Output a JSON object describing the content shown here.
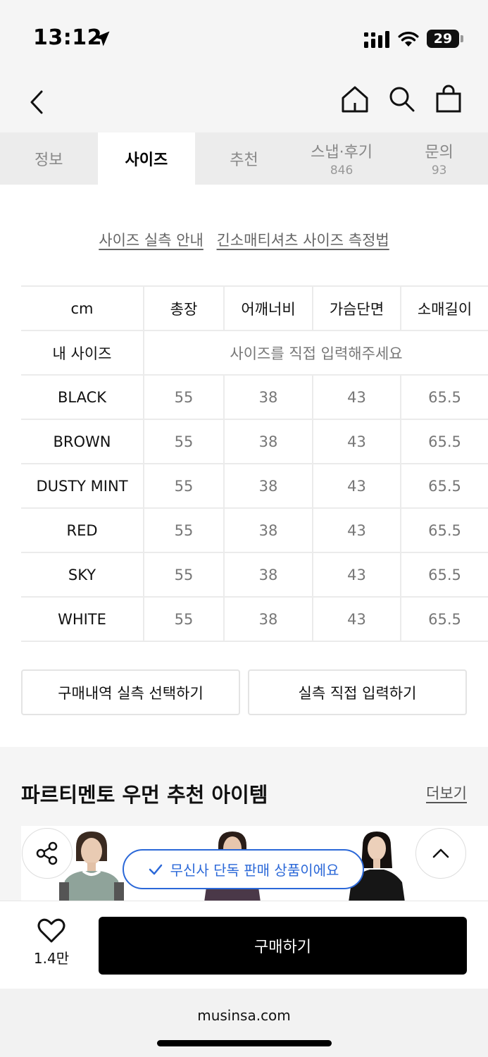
{
  "status": {
    "time": "13:12",
    "battery": "29"
  },
  "tabs": [
    {
      "label": "정보",
      "count": ""
    },
    {
      "label": "사이즈",
      "count": ""
    },
    {
      "label": "추천",
      "count": ""
    },
    {
      "label": "스냅·후기",
      "count": "846"
    },
    {
      "label": "문의",
      "count": "93"
    }
  ],
  "size_links": {
    "guide": "사이즈 실측 안내",
    "method": "긴소매티셔츠 사이즈 측정법"
  },
  "size_table": {
    "headers": [
      "cm",
      "총장",
      "어깨너비",
      "가슴단면",
      "소매길이"
    ],
    "my_size_label": "내 사이즈",
    "my_size_placeholder": "사이즈를 직접 입력해주세요",
    "rows": [
      {
        "name": "BLACK",
        "values": [
          "55",
          "38",
          "43",
          "65.5"
        ]
      },
      {
        "name": "BROWN",
        "values": [
          "55",
          "38",
          "43",
          "65.5"
        ]
      },
      {
        "name": "DUSTY MINT",
        "values": [
          "55",
          "38",
          "43",
          "65.5"
        ]
      },
      {
        "name": "RED",
        "values": [
          "55",
          "38",
          "43",
          "65.5"
        ]
      },
      {
        "name": "SKY",
        "values": [
          "55",
          "38",
          "43",
          "65.5"
        ]
      },
      {
        "name": "WHITE",
        "values": [
          "55",
          "38",
          "43",
          "65.5"
        ]
      }
    ]
  },
  "actions": {
    "history_select": "구매내역 실측 선택하기",
    "direct_input": "실측 직접 입력하기"
  },
  "recommend": {
    "title": "파르티멘토 우먼 추천 아이템",
    "more": "더보기"
  },
  "badge": "무신사 단독 판매 상품이에요",
  "bottom": {
    "like_count": "1.4만",
    "buy_label": "구매하기"
  },
  "browser": {
    "url": "musinsa.com"
  },
  "colors": {
    "accent_blue": "#2b68d8",
    "buy_bg": "#000000",
    "tab_bg": "#ececec"
  }
}
